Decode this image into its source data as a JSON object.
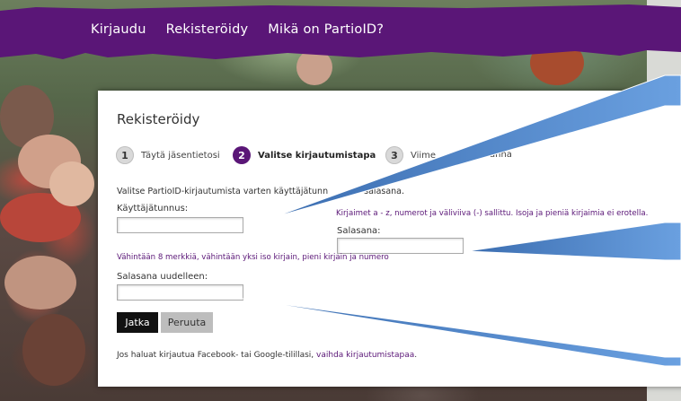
{
  "nav": {
    "items": [
      {
        "label": "Kirjaudu"
      },
      {
        "label": "Rekisteröidy"
      },
      {
        "label": "Mikä on PartioID?"
      }
    ],
    "color": "#5a1677"
  },
  "form": {
    "title": "Rekisteröidy",
    "steps": [
      {
        "number": "1",
        "label": "Täytä jäsentietosi"
      },
      {
        "number": "2",
        "label": "Valitse kirjautumistapa"
      },
      {
        "number": "3",
        "label": "Viime"
      },
      {
        "label_tail": "anna"
      }
    ],
    "intro_visible": "Valitse PartioID-kirjautumista varten käyttäjätunn",
    "intro_tail": "salasana.",
    "username": {
      "label": "Käyttäjätunnus:",
      "value": "",
      "hint": "Kirjaimet a - z, numerot ja väliviiva (-) sallittu. Isoja ja pieniä kirjaimia ei erotella."
    },
    "password": {
      "label": "Salasana:",
      "value": "",
      "hint": "Vähintään 8 merkkiä, vähintään yksi iso kirjain, pieni kirjain ja numero"
    },
    "password_repeat": {
      "label": "Salasana uudelleen:",
      "value": ""
    },
    "buttons": {
      "continue": "Jatka",
      "cancel": "Peruuta"
    },
    "footer": {
      "text": "Jos haluat kirjautua Facebook- tai Google-tilillasi,",
      "link": "vaihda kirjautumistapaa",
      "end": "."
    }
  },
  "colors": {
    "accent": "#5a1677",
    "callout_blue": "#4a7fc1"
  }
}
